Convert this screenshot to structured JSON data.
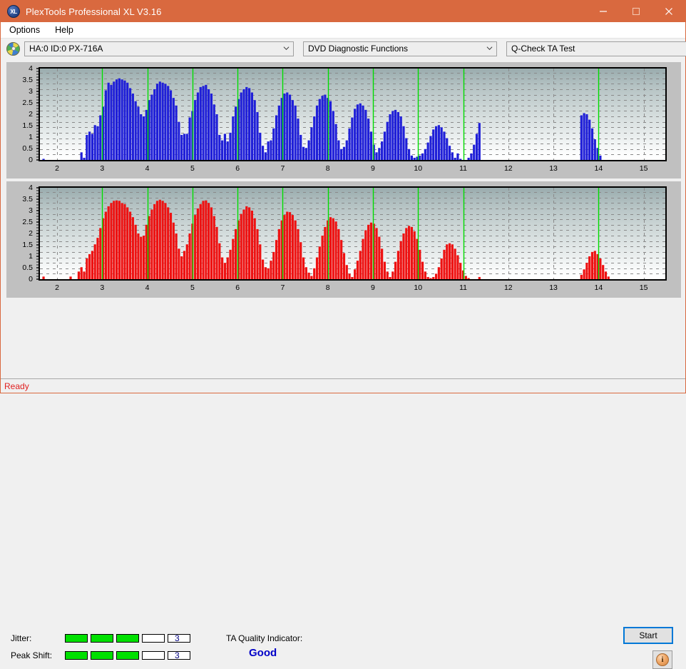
{
  "window": {
    "title": "PlexTools Professional XL V3.16",
    "icon": "plextools-disc-icon",
    "minimize_label": "—",
    "maximize_label": "□",
    "close_label": "✕"
  },
  "menubar": {
    "items": [
      {
        "label": "Options"
      },
      {
        "label": "Help"
      }
    ]
  },
  "toolbar": {
    "device_icon": "optical-disc-icon",
    "device_select": {
      "value": "HA:0 ID:0  PX-716A",
      "options": [
        "HA:0 ID:0  PX-716A"
      ]
    },
    "function_select": {
      "value": "DVD Diagnostic Functions",
      "options": [
        "DVD Diagnostic Functions"
      ]
    },
    "test_select": {
      "value": "Q-Check TA Test",
      "options": [
        "Q-Check TA Test"
      ]
    }
  },
  "charts": {
    "y_ticks": [
      "0",
      "0.5",
      "1",
      "1.5",
      "2",
      "2.5",
      "3",
      "3.5",
      "4"
    ],
    "x_ticks": [
      "2",
      "3",
      "4",
      "5",
      "6",
      "7",
      "8",
      "9",
      "10",
      "11",
      "12",
      "13",
      "14",
      "15"
    ],
    "marker_color": "#00dd00",
    "grid_color": "#808080"
  },
  "chart_data": [
    {
      "type": "bar",
      "name": "Jitter",
      "color": "#1f1fd8",
      "title": "",
      "xlabel": "",
      "ylabel": "",
      "xlim": [
        1.62,
        15.48
      ],
      "ylim": [
        0,
        4.2
      ],
      "y_ticks": [
        0,
        0.5,
        1,
        1.5,
        2,
        2.5,
        3,
        3.5,
        4
      ],
      "x_ticks": [
        2,
        3,
        4,
        5,
        6,
        7,
        8,
        9,
        10,
        11,
        12,
        13,
        14,
        15
      ],
      "grid": true,
      "markers": [
        3,
        4,
        5,
        6,
        7,
        8,
        9,
        10,
        11,
        14
      ],
      "x": [
        1.7,
        1.76,
        1.82,
        1.88,
        1.94,
        2.0,
        2.06,
        2.12,
        2.18,
        2.24,
        2.3,
        2.36,
        2.42,
        2.48,
        2.54,
        2.6,
        2.66,
        2.72,
        2.78,
        2.84,
        2.9,
        2.96,
        3.02,
        3.08,
        3.14,
        3.2,
        3.26,
        3.32,
        3.38,
        3.44,
        3.5,
        3.56,
        3.62,
        3.68,
        3.74,
        3.8,
        3.86,
        3.92,
        3.98,
        4.04,
        4.1,
        4.16,
        4.22,
        4.28,
        4.34,
        4.4,
        4.46,
        4.52,
        4.58,
        4.64,
        4.7,
        4.76,
        4.82,
        4.88,
        4.94,
        5.0,
        5.06,
        5.12,
        5.18,
        5.24,
        5.3,
        5.36,
        5.42,
        5.48,
        5.54,
        5.6,
        5.66,
        5.72,
        5.78,
        5.84,
        5.9,
        5.96,
        6.02,
        6.08,
        6.14,
        6.2,
        6.26,
        6.32,
        6.38,
        6.44,
        6.5,
        6.56,
        6.62,
        6.68,
        6.74,
        6.8,
        6.86,
        6.92,
        6.98,
        7.04,
        7.1,
        7.16,
        7.22,
        7.28,
        7.34,
        7.4,
        7.46,
        7.52,
        7.58,
        7.64,
        7.7,
        7.76,
        7.82,
        7.88,
        7.94,
        8.0,
        8.06,
        8.12,
        8.18,
        8.24,
        8.3,
        8.36,
        8.42,
        8.48,
        8.54,
        8.6,
        8.66,
        8.72,
        8.78,
        8.84,
        8.9,
        8.96,
        9.02,
        9.08,
        9.14,
        9.2,
        9.26,
        9.32,
        9.38,
        9.44,
        9.5,
        9.56,
        9.62,
        9.68,
        9.74,
        9.8,
        9.86,
        9.92,
        9.98,
        10.04,
        10.1,
        10.16,
        10.22,
        10.28,
        10.34,
        10.4,
        10.46,
        10.52,
        10.58,
        10.64,
        10.7,
        10.76,
        10.82,
        10.88,
        10.94,
        11.0,
        11.06,
        11.12,
        11.18,
        11.24,
        11.3,
        11.36,
        13.62,
        13.68,
        13.74,
        13.8,
        13.86,
        13.92,
        13.98,
        14.04,
        14.1,
        14.16,
        14.22,
        14.28
      ],
      "values": [
        0.05,
        0,
        0,
        0,
        0,
        0,
        0,
        0,
        0,
        0,
        0,
        0,
        0,
        0,
        0.35,
        0.1,
        1.15,
        1.3,
        1.2,
        1.6,
        1.55,
        2.05,
        2.45,
        3.2,
        3.55,
        3.45,
        3.6,
        3.7,
        3.75,
        3.7,
        3.65,
        3.55,
        3.3,
        3.05,
        2.7,
        2.45,
        2.1,
        2.0,
        2.3,
        2.75,
        3.0,
        3.25,
        3.5,
        3.6,
        3.55,
        3.5,
        3.4,
        3.2,
        2.85,
        2.5,
        1.75,
        1.15,
        1.2,
        1.2,
        1.95,
        2.25,
        2.75,
        3.1,
        3.35,
        3.4,
        3.45,
        3.25,
        3.05,
        2.55,
        2.1,
        1.15,
        0.9,
        1.2,
        0.85,
        1.25,
        2.0,
        2.45,
        2.8,
        3.1,
        3.25,
        3.35,
        3.3,
        3.1,
        2.75,
        2.2,
        1.25,
        0.65,
        0.35,
        0.85,
        0.9,
        1.45,
        2.05,
        2.5,
        2.85,
        3.05,
        3.1,
        3.0,
        2.75,
        2.5,
        1.9,
        1.15,
        0.6,
        0.55,
        0.9,
        1.5,
        2.0,
        2.5,
        2.8,
        2.95,
        3.0,
        2.85,
        2.7,
        2.25,
        1.65,
        0.9,
        0.5,
        0.6,
        0.9,
        1.45,
        1.95,
        2.35,
        2.55,
        2.6,
        2.5,
        2.3,
        1.9,
        1.3,
        0.7,
        0.35,
        0.55,
        0.85,
        1.3,
        1.75,
        2.1,
        2.25,
        2.3,
        2.2,
        2.0,
        1.55,
        1.0,
        0.5,
        0.2,
        0.1,
        0.15,
        0.2,
        0.3,
        0.5,
        0.8,
        1.1,
        1.4,
        1.55,
        1.6,
        1.5,
        1.3,
        1.0,
        0.65,
        0.35,
        0.1,
        0.3,
        0.05,
        0,
        0,
        0.1,
        0.3,
        0.7,
        1.2,
        1.7,
        2.05,
        2.15,
        2.1,
        1.85,
        1.45,
        0.95,
        0.55,
        0.2
      ]
    },
    {
      "type": "bar",
      "name": "Peak Shift",
      "color": "#ee1111",
      "title": "",
      "xlabel": "",
      "ylabel": "",
      "xlim": [
        1.62,
        15.48
      ],
      "ylim": [
        0,
        4.2
      ],
      "y_ticks": [
        0,
        0.5,
        1,
        1.5,
        2,
        2.5,
        3,
        3.5,
        4
      ],
      "x_ticks": [
        2,
        3,
        4,
        5,
        6,
        7,
        8,
        9,
        10,
        11,
        12,
        13,
        14,
        15
      ],
      "grid": true,
      "markers": [
        3,
        4,
        5,
        6,
        7,
        8,
        9,
        10,
        11,
        14
      ],
      "x": [
        1.7,
        1.76,
        1.82,
        1.88,
        1.94,
        2.0,
        2.06,
        2.12,
        2.18,
        2.24,
        2.3,
        2.36,
        2.42,
        2.48,
        2.54,
        2.6,
        2.66,
        2.72,
        2.78,
        2.84,
        2.9,
        2.96,
        3.02,
        3.08,
        3.14,
        3.2,
        3.26,
        3.32,
        3.38,
        3.44,
        3.5,
        3.56,
        3.62,
        3.68,
        3.74,
        3.8,
        3.86,
        3.92,
        3.98,
        4.04,
        4.1,
        4.16,
        4.22,
        4.28,
        4.34,
        4.4,
        4.46,
        4.52,
        4.58,
        4.64,
        4.7,
        4.76,
        4.82,
        4.88,
        4.94,
        5.0,
        5.06,
        5.12,
        5.18,
        5.24,
        5.3,
        5.36,
        5.42,
        5.48,
        5.54,
        5.6,
        5.66,
        5.72,
        5.78,
        5.84,
        5.9,
        5.96,
        6.02,
        6.08,
        6.14,
        6.2,
        6.26,
        6.32,
        6.38,
        6.44,
        6.5,
        6.56,
        6.62,
        6.68,
        6.74,
        6.8,
        6.86,
        6.92,
        6.98,
        7.04,
        7.1,
        7.16,
        7.22,
        7.28,
        7.34,
        7.4,
        7.46,
        7.52,
        7.58,
        7.64,
        7.7,
        7.76,
        7.82,
        7.88,
        7.94,
        8.0,
        8.06,
        8.12,
        8.18,
        8.24,
        8.3,
        8.36,
        8.42,
        8.48,
        8.54,
        8.6,
        8.66,
        8.72,
        8.78,
        8.84,
        8.9,
        8.96,
        9.02,
        9.08,
        9.14,
        9.2,
        9.26,
        9.32,
        9.38,
        9.44,
        9.5,
        9.56,
        9.62,
        9.68,
        9.74,
        9.8,
        9.86,
        9.92,
        9.98,
        10.04,
        10.1,
        10.16,
        10.22,
        10.28,
        10.34,
        10.4,
        10.46,
        10.52,
        10.58,
        10.64,
        10.7,
        10.76,
        10.82,
        10.88,
        10.94,
        11.0,
        11.06,
        11.12,
        11.18,
        11.24,
        11.3,
        11.36,
        13.62,
        13.68,
        13.74,
        13.8,
        13.86,
        13.92,
        13.98,
        14.04,
        14.1,
        14.16,
        14.22,
        14.28
      ],
      "values": [
        0.12,
        0,
        0,
        0,
        0,
        0,
        0,
        0,
        0,
        0,
        0.12,
        0,
        0,
        0.35,
        0.55,
        0.35,
        0.95,
        1.15,
        1.3,
        1.6,
        1.9,
        2.35,
        2.8,
        3.1,
        3.35,
        3.5,
        3.6,
        3.62,
        3.6,
        3.5,
        3.45,
        3.3,
        3.1,
        2.85,
        2.5,
        2.1,
        1.95,
        2.0,
        2.5,
        2.9,
        3.2,
        3.45,
        3.6,
        3.65,
        3.6,
        3.5,
        3.3,
        3.05,
        2.6,
        2.1,
        1.4,
        1.05,
        1.3,
        1.6,
        2.1,
        2.55,
        2.95,
        3.25,
        3.45,
        3.6,
        3.62,
        3.5,
        3.3,
        2.9,
        2.4,
        1.65,
        1.0,
        0.75,
        1.0,
        1.35,
        1.85,
        2.3,
        2.7,
        3.0,
        3.2,
        3.35,
        3.3,
        3.15,
        2.8,
        2.3,
        1.6,
        0.9,
        0.55,
        0.5,
        0.85,
        1.25,
        1.8,
        2.3,
        2.7,
        2.95,
        3.1,
        3.08,
        2.95,
        2.7,
        2.3,
        1.7,
        1.0,
        0.55,
        0.3,
        0.15,
        0.5,
        1.0,
        1.5,
        2.0,
        2.4,
        2.7,
        2.85,
        2.8,
        2.65,
        2.3,
        1.8,
        1.2,
        0.65,
        0.25,
        0.1,
        0.45,
        0.85,
        1.3,
        1.85,
        2.25,
        2.5,
        2.6,
        2.55,
        2.35,
        1.95,
        1.4,
        0.8,
        0.35,
        0.1,
        0.35,
        0.8,
        1.3,
        1.75,
        2.1,
        2.35,
        2.45,
        2.4,
        2.2,
        1.85,
        1.35,
        0.8,
        0.35,
        0.1,
        0.05,
        0.1,
        0.25,
        0.55,
        0.95,
        1.35,
        1.6,
        1.65,
        1.6,
        1.4,
        1.1,
        0.75,
        0.4,
        0.15,
        0.05,
        0,
        0,
        0,
        0.1,
        0.2,
        0.45,
        0.75,
        1.05,
        1.25,
        1.3,
        1.15,
        0.95,
        0.65,
        0.35,
        0.12
      ]
    }
  ],
  "results": {
    "jitter_label": "Jitter:",
    "jitter_value": "3",
    "jitter_filled": 3,
    "jitter_total": 5,
    "peak_shift_label": "Peak Shift:",
    "peak_shift_value": "3",
    "peak_shift_filled": 3,
    "peak_shift_total": 5,
    "ta_quality_label": "TA Quality Indicator:",
    "ta_quality_value": "Good",
    "start_label": "Start",
    "info_label": "i"
  },
  "statusbar": {
    "text": "Ready"
  }
}
